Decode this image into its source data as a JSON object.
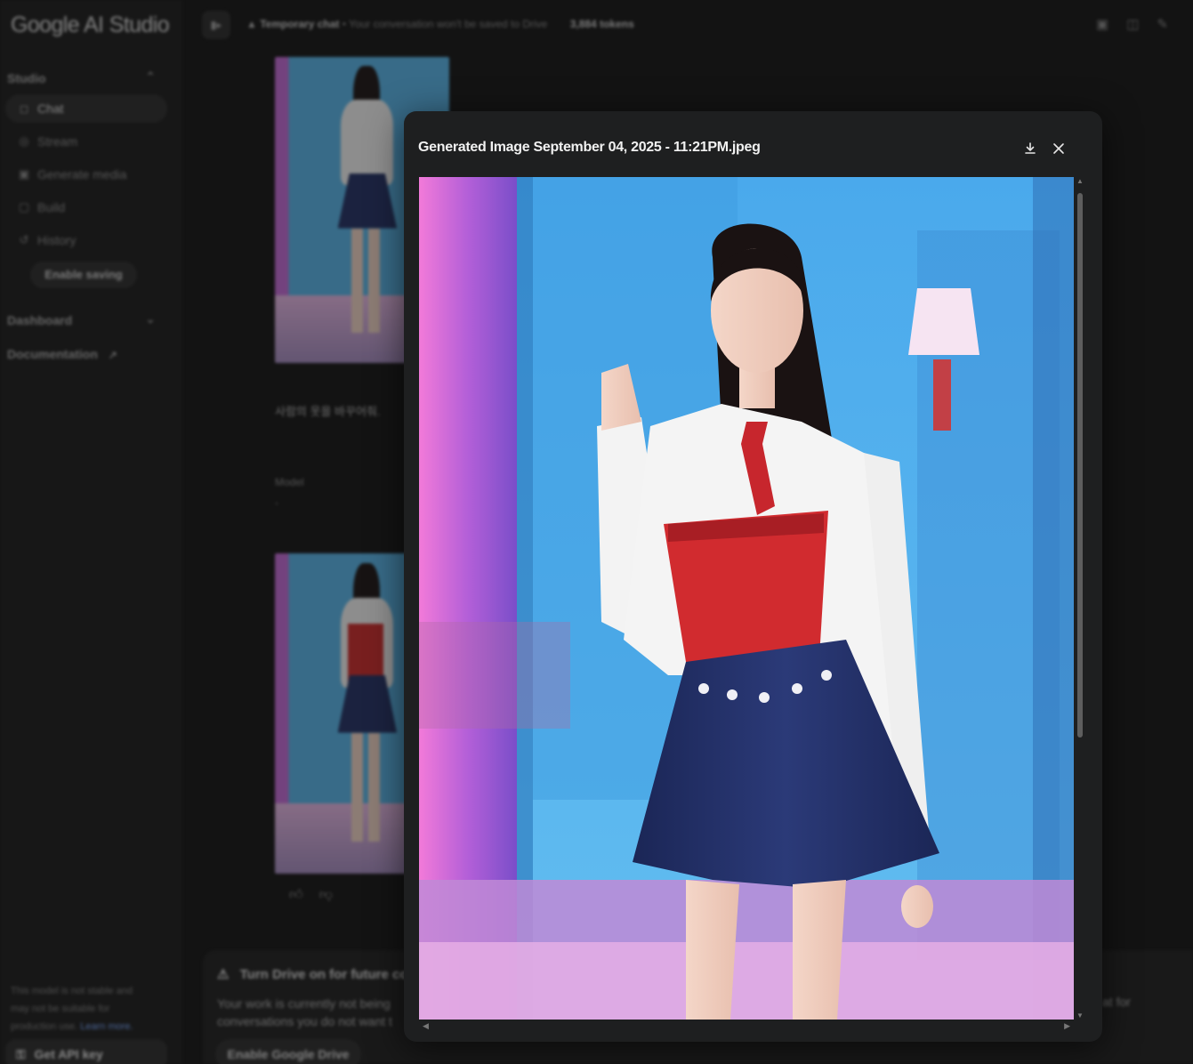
{
  "app": {
    "logo": "Google AI Studio"
  },
  "sidebar": {
    "studio_label": "Studio",
    "items": [
      {
        "label": "Chat",
        "icon": "chat-icon"
      },
      {
        "label": "Stream",
        "icon": "stream-icon"
      },
      {
        "label": "Generate media",
        "icon": "media-icon"
      },
      {
        "label": "Build",
        "icon": "build-icon"
      },
      {
        "label": "History",
        "icon": "history-icon"
      }
    ],
    "enable_saving": "Enable saving",
    "dashboard_label": "Dashboard",
    "documentation_label": "Documentation",
    "note": "This model is not stable and may not be suitable for production use.",
    "learn_more": "Learn more.",
    "get_api_key": "Get API key"
  },
  "topbar": {
    "title": "Temporary chat",
    "subtitle": "Your conversation won't be saved to Drive",
    "tokens": "3,884 tokens"
  },
  "chat": {
    "user_prompt": "사람의 옷을 바꾸어줘.",
    "model_label": "Model",
    "model_text": "-"
  },
  "banner": {
    "title": "Turn Drive on for future cor",
    "body": "Your work is currently not being conversations you do not want t",
    "right_text": "at for",
    "button": "Enable Google Drive"
  },
  "modal": {
    "title": "Generated Image September 04, 2025 - 11:21PM.jpeg",
    "download_icon": "download-icon",
    "close_icon": "close-icon"
  },
  "colors": {
    "background": "#131313",
    "sidebar": "#1b1b1b",
    "modal": "#1e1f20",
    "skirt": "#223063",
    "corset": "#cc2a2a",
    "stage_blue": "#59b4ea"
  }
}
